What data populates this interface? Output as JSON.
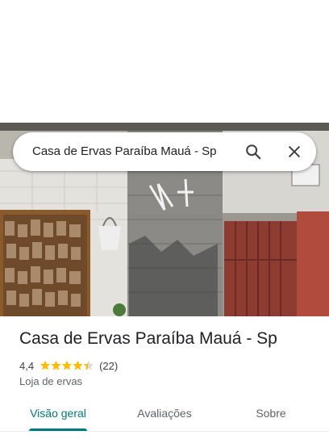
{
  "search": {
    "query": "Casa de Ervas Paraíba Mauá - Sp",
    "search_icon": "search-icon",
    "close_icon": "close-icon"
  },
  "photo": {
    "description_icon": "place-photo"
  },
  "place": {
    "name": "Casa de Ervas Paraíba Mauá - Sp",
    "rating": "4,4",
    "rating_value": 4.4,
    "review_count": "(22)",
    "category": "Loja de ervas"
  },
  "tabs": [
    {
      "label": "Visão geral",
      "active": true
    },
    {
      "label": "Avaliações",
      "active": false
    },
    {
      "label": "Sobre",
      "active": false
    }
  ],
  "colors": {
    "accent": "#00797d",
    "star": "#fbbc04",
    "star_empty": "#dadce0"
  }
}
